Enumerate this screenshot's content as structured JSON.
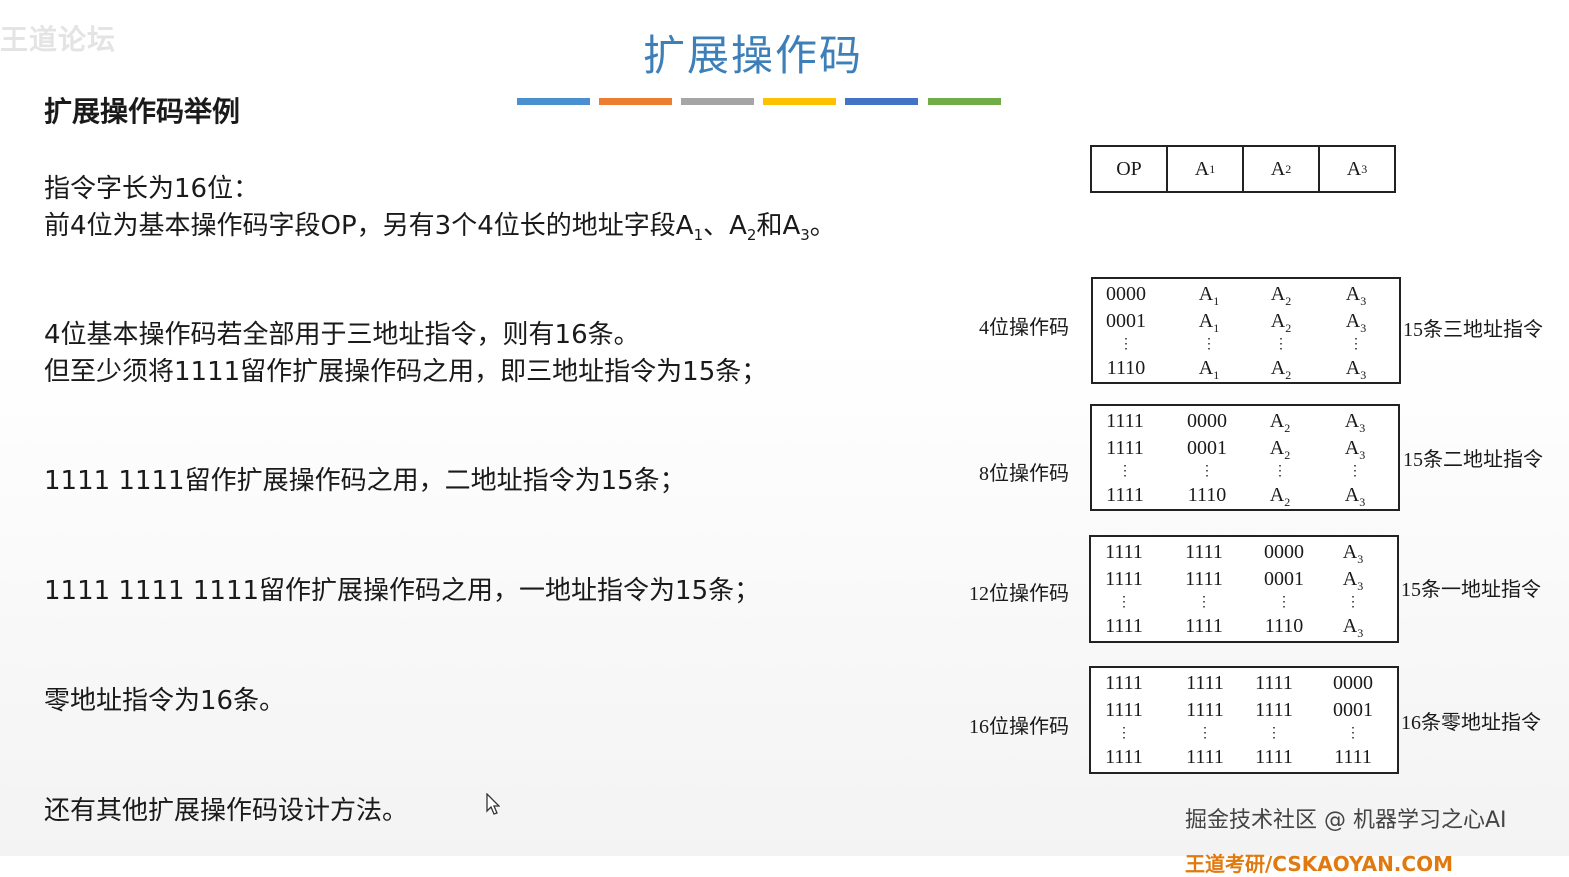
{
  "watermark_top": "王道论坛",
  "title": "扩展操作码",
  "subtitle": "扩展操作码举例",
  "accent_colors": [
    "#4a90d0",
    "#ed7d31",
    "#a5a5a5",
    "#ffc000",
    "#4472c4",
    "#70ad47"
  ],
  "text": {
    "line1": "指令字长为16位：",
    "line2_a": "前4位为基本操作码字段OP，另有3个4位长的地址字段A",
    "line2_b": "、A",
    "line2_c": "和A",
    "line2_d": "。",
    "sub1": "1",
    "sub2": "2",
    "sub3": "3",
    "line3": "4位基本操作码若全部用于三地址指令，则有16条。",
    "line4": "但至少须将1111留作扩展操作码之用，即三地址指令为15条；",
    "line5": "1111 1111留作扩展操作码之用，二地址指令为15条；",
    "line6": "1111 1111 1111留作扩展操作码之用，一地址指令为15条；",
    "line7": "零地址指令为16条。",
    "line8": "还有其他扩展操作码设计方法。"
  },
  "format": {
    "op": "OP",
    "a": "A",
    "s1": "1",
    "s2": "2",
    "s3": "3"
  },
  "groups": [
    {
      "left_label": "4位操作码",
      "right_label": "15条三地址指令",
      "cols": [
        [
          "0000",
          "0001",
          "⋮",
          "1110"
        ],
        [
          "A1",
          "A1",
          "⋮",
          "A1"
        ],
        [
          "A2",
          "A2",
          "⋮",
          "A2"
        ],
        [
          "A3",
          "A3",
          "⋮",
          "A3"
        ]
      ]
    },
    {
      "left_label": "8位操作码",
      "right_label": "15条二地址指令",
      "cols": [
        [
          "1111",
          "1111",
          "⋮",
          "1111"
        ],
        [
          "0000",
          "0001",
          "⋮",
          "1110"
        ],
        [
          "A2",
          "A2",
          "⋮",
          "A2"
        ],
        [
          "A3",
          "A3",
          "⋮",
          "A3"
        ]
      ]
    },
    {
      "left_label": "12位操作码",
      "right_label": "15条一地址指令",
      "cols": [
        [
          "1111",
          "1111",
          "⋮",
          "1111"
        ],
        [
          "1111",
          "1111",
          "⋮",
          "1111"
        ],
        [
          "0000",
          "0001",
          "⋮",
          "1110"
        ],
        [
          "A3",
          "A3",
          "⋮",
          "A3"
        ]
      ]
    },
    {
      "left_label": "16位操作码",
      "right_label": "16条零地址指令",
      "cols": [
        [
          "1111",
          "1111",
          "⋮",
          "1111"
        ],
        [
          "1111",
          "1111",
          "⋮",
          "1111"
        ],
        [
          "1111",
          "1111",
          "⋮",
          "1111"
        ],
        [
          "0000",
          "0001",
          "⋮",
          "1111"
        ]
      ]
    }
  ],
  "watermark_bottom": "掘金技术社区 @ 机器学习之心AI",
  "watermark_bottom2": "王道考研/CSKAOYAN.COM"
}
